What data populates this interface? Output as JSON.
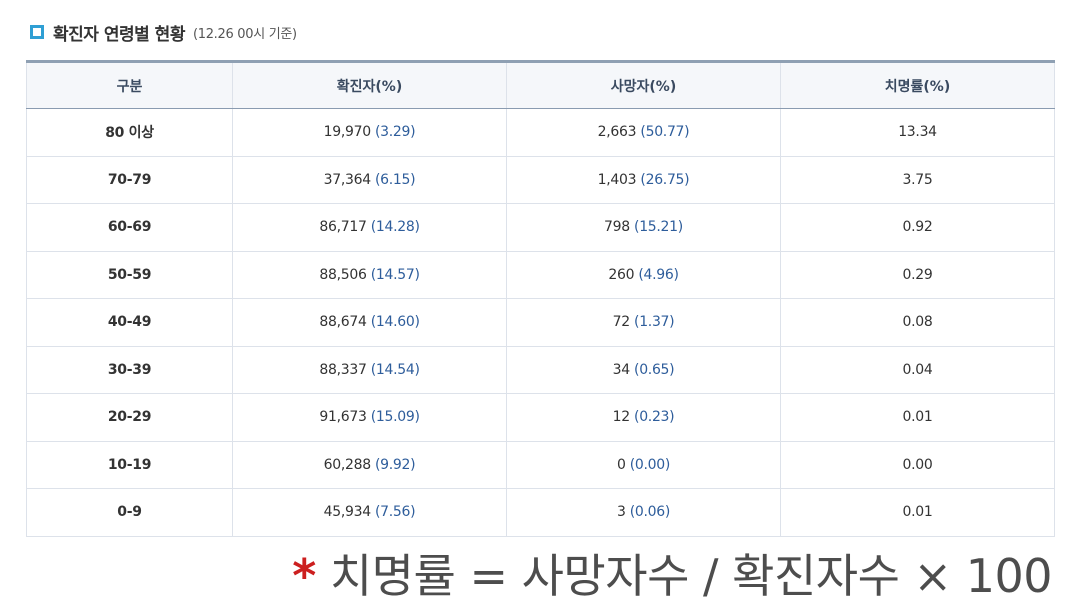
{
  "title": {
    "main": "확진자 연령별 현황",
    "sub": "(12.26 00시 기준)",
    "icon": "square-bullet-icon",
    "icon_color": "#2f9fd4"
  },
  "table": {
    "headers": [
      "구분",
      "확진자(%)",
      "사망자(%)",
      "치명률(%)"
    ],
    "rows": [
      {
        "age": "80 이상",
        "cases": "19,970",
        "cases_pct": "(3.29)",
        "deaths": "2,663",
        "deaths_pct": "(50.77)",
        "fatality": "13.34"
      },
      {
        "age": "70-79",
        "cases": "37,364",
        "cases_pct": "(6.15)",
        "deaths": "1,403",
        "deaths_pct": "(26.75)",
        "fatality": "3.75"
      },
      {
        "age": "60-69",
        "cases": "86,717",
        "cases_pct": "(14.28)",
        "deaths": "798",
        "deaths_pct": "(15.21)",
        "fatality": "0.92"
      },
      {
        "age": "50-59",
        "cases": "88,506",
        "cases_pct": "(14.57)",
        "deaths": "260",
        "deaths_pct": "(4.96)",
        "fatality": "0.29"
      },
      {
        "age": "40-49",
        "cases": "88,674",
        "cases_pct": "(14.60)",
        "deaths": "72",
        "deaths_pct": "(1.37)",
        "fatality": "0.08"
      },
      {
        "age": "30-39",
        "cases": "88,337",
        "cases_pct": "(14.54)",
        "deaths": "34",
        "deaths_pct": "(0.65)",
        "fatality": "0.04"
      },
      {
        "age": "20-29",
        "cases": "91,673",
        "cases_pct": "(15.09)",
        "deaths": "12",
        "deaths_pct": "(0.23)",
        "fatality": "0.01"
      },
      {
        "age": "10-19",
        "cases": "60,288",
        "cases_pct": "(9.92)",
        "deaths": "0",
        "deaths_pct": "(0.00)",
        "fatality": "0.00"
      },
      {
        "age": "0-9",
        "cases": "45,934",
        "cases_pct": "(7.56)",
        "deaths": "3",
        "deaths_pct": "(0.06)",
        "fatality": "0.01"
      }
    ]
  },
  "footnote": {
    "star": "*",
    "text": "치명률 = 사망자수 / 확진자수 × 100",
    "star_color": "#cc1f1f"
  }
}
